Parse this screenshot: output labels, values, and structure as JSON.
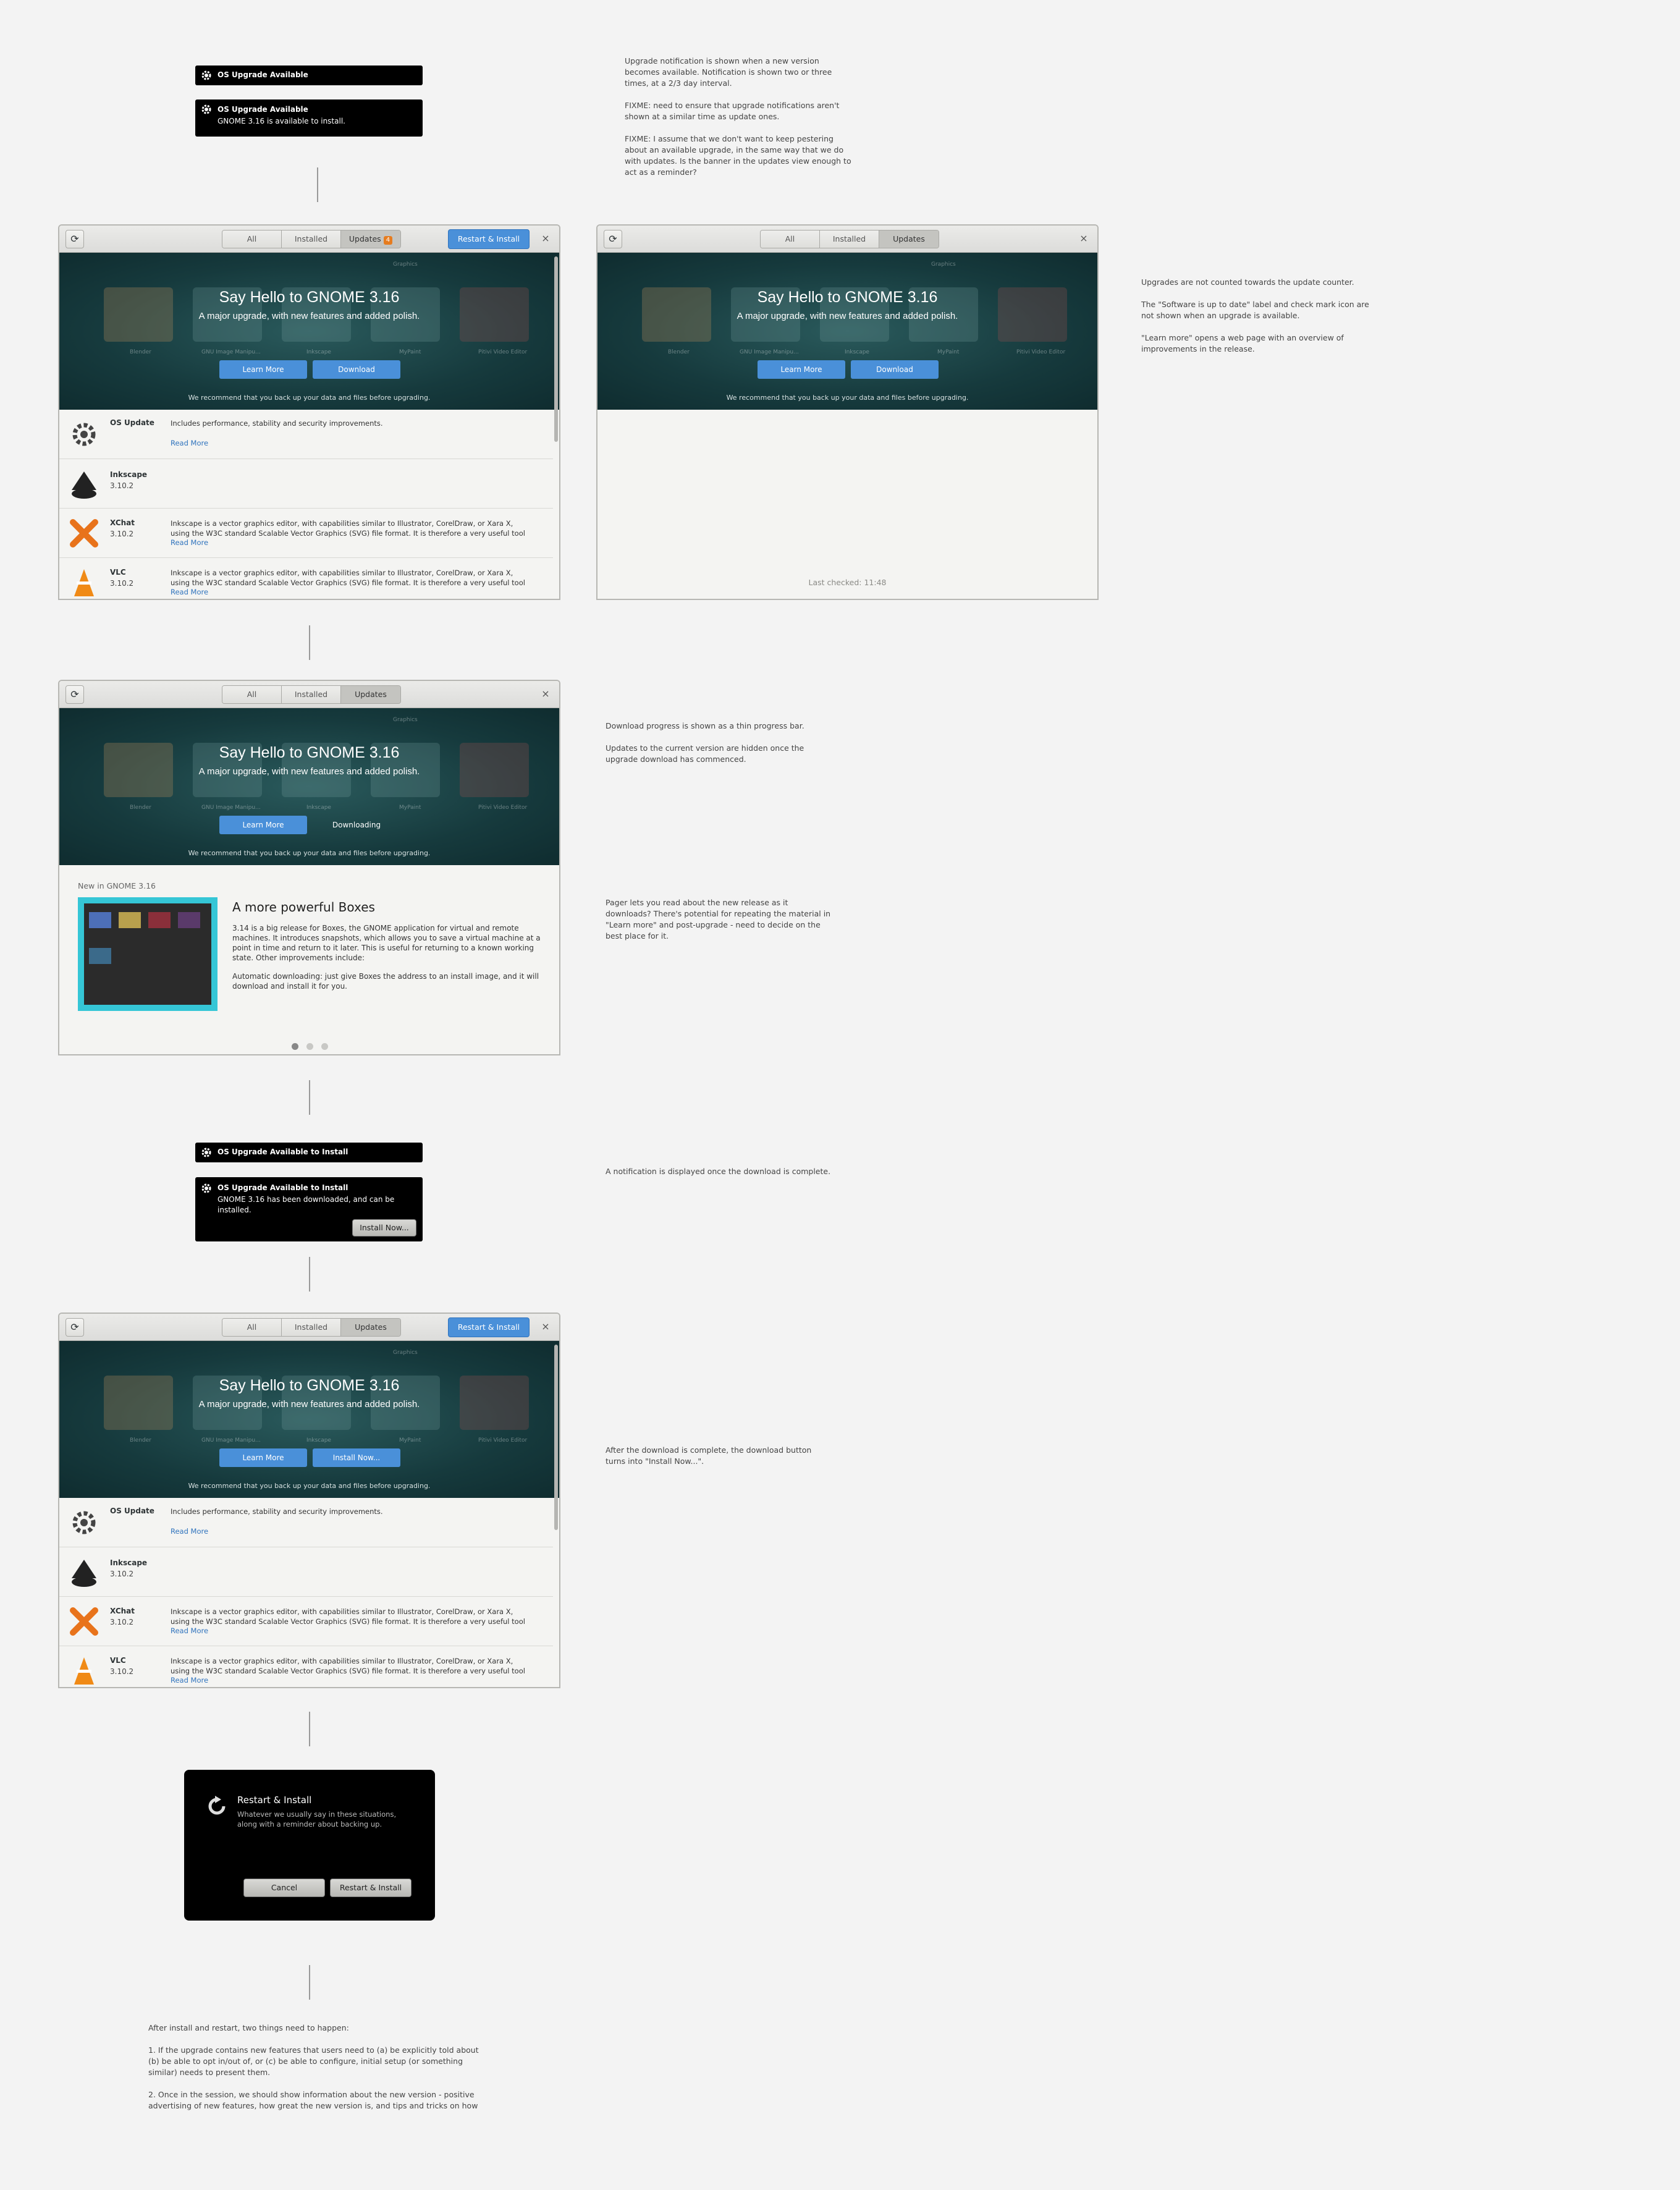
{
  "notif_available": {
    "collapsed_title": "OS Upgrade Available",
    "title": "OS Upgrade Available",
    "body": "GNOME 3.16 is available to install."
  },
  "notif_install": {
    "collapsed_title": "OS Upgrade Available to Install",
    "title": "OS Upgrade Available to Install",
    "body_line1": "GNOME 3.16 has been downloaded, and can be",
    "body_line2": "installed.",
    "button": "Install Now..."
  },
  "notes": {
    "n1_p1_l1": "Upgrade notification is shown when a new version",
    "n1_p1_l2": "becomes available. Notification is shown two or three",
    "n1_p1_l3": "times, at a 2/3 day interval.",
    "n1_p2_l1": "FIXME: need to ensure that upgrade notifications aren't",
    "n1_p2_l2": "shown at a similar time as update ones.",
    "n1_p3_l1": "FIXME: I assume that we don't want to keep pestering",
    "n1_p3_l2": "about an available upgrade, in the same way that we do",
    "n1_p3_l3": "with updates. Is the banner in the updates view enough to",
    "n1_p3_l4": "act as a reminder?",
    "n2_p1": "Upgrades are not counted towards the update counter.",
    "n2_p2_l1": "The \"Software is up to date\" label and check mark icon are",
    "n2_p2_l2": "not shown when an upgrade is available.",
    "n2_p3_l1": "\"Learn more\" opens a web page with an overview of",
    "n2_p3_l2": "improvements in the release.",
    "n3_p1": "Download progress is shown as a thin progress bar.",
    "n3_p2_l1": "Updates to the current version are hidden once the",
    "n3_p2_l2": "upgrade download has commenced.",
    "n4_l1": "Pager lets you read about the new release as it",
    "n4_l2": "downloads? There's potential for repeating the material in",
    "n4_l3": "\"Learn more\" and post-upgrade - need to decide on the",
    "n4_l4": "best place for it.",
    "n5": "A notification is displayed once the download is complete.",
    "n6_l1": "After the download is complete, the download button",
    "n6_l2": "turns into \"Install Now...\".",
    "n7_p1": "After install and restart, two things need to happen:",
    "n7_p2_l1": "1. If the upgrade contains new features that users need to (a) be explicitly told about",
    "n7_p2_l2": "(b) be able to opt in/out of, or (c) be able to configure, initial setup (or something",
    "n7_p2_l3": "similar) needs to present them.",
    "n7_p3_l1": "2. Once in the session, we should show information about the new version - positive",
    "n7_p3_l2": "advertising of new features, how great the new version is, and tips and tricks on how"
  },
  "tabs": {
    "all": "All",
    "installed": "Installed",
    "updates": "Updates",
    "updates_count": "4"
  },
  "header": {
    "restart_install": "Restart & Install",
    "refresh_icon": "refresh-icon",
    "close": "×"
  },
  "banner": {
    "title": "Say Hello to GNOME 3.16",
    "subtitle": "A major upgrade, with new features and added polish.",
    "learn_more": "Learn More",
    "download": "Download",
    "downloading": "Downloading",
    "install_now": "Install Now...",
    "warning": "We recommend that you back up your data and files before upgrading.",
    "tiles": [
      "Blender",
      "GNU Image Manipu...",
      "Inkscape",
      "MyPaint",
      "Pitivi Video Editor",
      "Graphics"
    ]
  },
  "list": {
    "os_update": {
      "name": "OS Update",
      "desc": "Includes performance, stability and security improvements.",
      "more": "Read More"
    },
    "inkscape": {
      "name": "Inkscape",
      "version": "3.10.2"
    },
    "xchat": {
      "name": "XChat",
      "version": "3.10.2",
      "desc1": "Inkscape is a vector graphics editor, with capabilities similar to Illustrator, CorelDraw, or Xara X,",
      "desc2": "using the W3C standard Scalable Vector Graphics (SVG) file format.  It is therefore a very useful tool",
      "more": "Read More"
    },
    "vlc": {
      "name": "VLC",
      "version": "3.10.2",
      "desc1": "Inkscape is a vector graphics editor, with capabilities similar to Illustrator, CorelDraw, or Xara X,",
      "desc2": "using the W3C standard Scalable Vector Graphics (SVG) file format.  It is therefore a very useful tool",
      "more": "Read More"
    }
  },
  "last_checked": "Last checked: 11:48",
  "pager": {
    "heading": "New in GNOME 3.16",
    "title": "A more powerful Boxes",
    "p1_l1": "3.14 is a big release for Boxes, the GNOME application for virtual and remote",
    "p1_l2": "machines. It introduces snapshots, which allows you to save a virtual machine at a",
    "p1_l3": "point in time and return to it later. This is useful for returning to a known working",
    "p1_l4": "state. Other improvements include:",
    "p2_l1": "Automatic downloading: just give Boxes the address to an install image, and it will",
    "p2_l2": "download and install it for you."
  },
  "dialog": {
    "title": "Restart & Install",
    "body_l1": "Whatever we usually say in these situations,",
    "body_l2": "along with a reminder about backing up.",
    "cancel": "Cancel",
    "confirm": "Restart & Install"
  },
  "colors": {
    "accent": "#4a90d9",
    "badge": "#e67c1f",
    "banner": "#163a3d"
  }
}
